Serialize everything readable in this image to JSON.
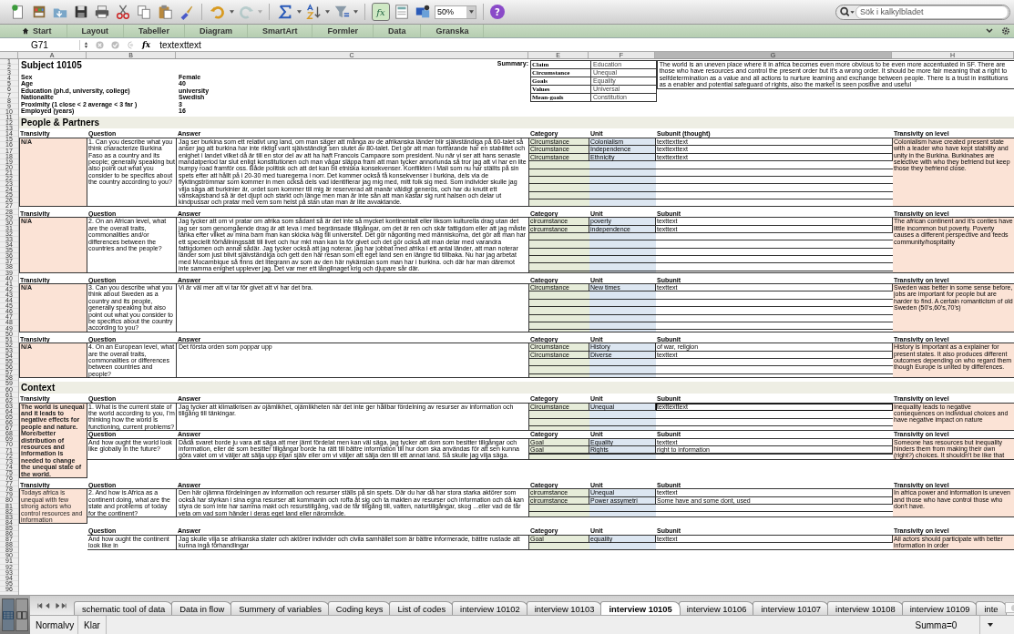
{
  "toolbar": {
    "zoom": "50%",
    "formula_button": "fx",
    "help": "?",
    "search_placeholder": "Sök i kalkylbladet"
  },
  "ribbon": {
    "tabs": [
      {
        "label": "Start",
        "selected": false
      },
      {
        "label": "Layout",
        "selected": false
      },
      {
        "label": "Tabeller",
        "selected": false
      },
      {
        "label": "Diagram",
        "selected": false
      },
      {
        "label": "SmartArt",
        "selected": false
      },
      {
        "label": "Formler",
        "selected": false
      },
      {
        "label": "Data",
        "selected": false
      },
      {
        "label": "Granska",
        "selected": false
      }
    ]
  },
  "formula_bar": {
    "cell": "G71",
    "fx": "fx",
    "value": "textexttext"
  },
  "columns": [
    {
      "label": "A",
      "selected": false
    },
    {
      "label": "B",
      "selected": false
    },
    {
      "label": "C",
      "selected": false
    },
    {
      "label": "E",
      "selected": false
    },
    {
      "label": "F",
      "selected": false
    },
    {
      "label": "G",
      "selected": true
    },
    {
      "label": "H",
      "selected": false
    }
  ],
  "row_numbers": [
    "1",
    "2",
    "3",
    "4",
    "5",
    "6",
    "7",
    "8",
    "9",
    "10",
    "11",
    "12",
    "13",
    "14",
    "15",
    "16",
    "17",
    "18",
    "19",
    "20",
    "21",
    "22",
    "23",
    "24",
    "25",
    "26",
    "27",
    "28",
    "29",
    "30",
    "31",
    "32",
    "33",
    "34",
    "35",
    "36",
    "37",
    "38",
    "39",
    "40",
    "41",
    "42",
    "43",
    "44",
    "45",
    "46",
    "47",
    "48",
    "49",
    "50",
    "51",
    "52",
    "53",
    "54",
    "55",
    "56",
    "57",
    "58",
    "59",
    "60",
    "61",
    "62",
    "63",
    "64",
    "65",
    "66",
    "67",
    "68",
    "69",
    "70",
    "71",
    "72",
    "73",
    "74",
    "75",
    "76",
    "77",
    "78",
    "79",
    "80",
    "81",
    "82",
    "83",
    "84",
    "85",
    "86",
    "87",
    "88",
    "89",
    "90",
    "91",
    "92",
    "93",
    "94",
    "95",
    "96"
  ],
  "subject": {
    "title": "Subject 10105",
    "fields": [
      {
        "label": "Sex",
        "value": "Female"
      },
      {
        "label": "Age",
        "value": "40"
      },
      {
        "label": "Education (ph.d, university, college)",
        "value": "university"
      },
      {
        "label": "Nationalite",
        "value": "Swedish"
      },
      {
        "label": "Proximity (1 close < 2 average < 3 far )",
        "value": "3"
      },
      {
        "label": "Employed (years)",
        "value": "16"
      }
    ],
    "summary_label": "Summary:",
    "summary": [
      {
        "key": "Claim",
        "value": "Education"
      },
      {
        "key": "Circumstance",
        "value": "Unequal"
      },
      {
        "key": "Goals",
        "value": "Equality"
      },
      {
        "key": "Values",
        "value": "Universal"
      },
      {
        "key": "Mean-goals",
        "value": "Constitution"
      }
    ],
    "summary_text": "The world is an uneven place where it in africa becomes even more obvious to be even more accentuated in SF. There are those who have resources and control the present order but it's a wrong order. It should be more fair meaning that a right to selfdetermination as a value and all actions to nurture learning and exchange between people. There is a trust in institutions as a enabler and potential safeguard of rights, also the market is seen positive and useful"
  },
  "sections": [
    {
      "title": "People & Partners",
      "blocks": [
        {
          "transivity": "N/A",
          "bold": true,
          "parts": [
            {
              "headers": {
                "transivity": "Transivity",
                "question": "Question",
                "answer": "Answer",
                "category": "Category",
                "unit": "Unit",
                "subunit": "Subunit (thought)",
                "level": "Transivity on level"
              },
              "question": "1. Can you describe what you think characterize Burkina Faso as a country and its people; generally speaking but also point out what you consider to be specifics about the country according to you?",
              "answer": "Jag ser burkina som ett relativt ung land, om man säger att många av de afrikanska länder blir självständiga på 60-talet så anser jag att burkina har inte riktigt varit självständigt sen slutet av 80-talet. Det gör att man fortfarande har en stabilitet och enighet i landet vilket då är till en stor del av att ha haft Francois Campaore som president. Nu när vi ser att hans senaste mandatperiod tar slut enligt konstitutionen och man vågar släppa fram att man tycker annorlunda så tror jag att vi har en lite bumpy road framför oss. Både politisk och att det kan bli etniska konsekvenser. Konflikten i Mali som nu har ställts på sin spets efter att hållt på i 20-30 med tuaregerna i norr. Det kommer också få konsekvenser i burkina, dels via de flyktingströmmar som kommer in men också dels vad identifierar jag mig med, mitt folk sig med. Som individer skulle jag vilja säga att burkinier är, ordet som kommer till mig är reserverad att manär väldigt generös, och har du knutit ett vänskapsband så är det djupt och starkt och länge men man är inte sån att man kastar sig runt halsen och delar ut kindpussar och pratar med vem som helst på stan utan man är lite avvaktande.",
              "codes": [
                {
                  "category": "Circumstance",
                  "unit": "Colonialism",
                  "subunit": "texttexttext",
                  "selected": false
                },
                {
                  "category": "Circumstance",
                  "unit": "Independence",
                  "subunit": "texttexttext",
                  "selected": false
                },
                {
                  "category": "Circumstance",
                  "unit": "Ethnicity",
                  "subunit": "texttexttext",
                  "selected": false
                }
              ],
              "level": "Colonialism have created present state with a leader who have kept stability and unity in the Burkina. Burkinabes are selective with who they befriend but keep those they befriend close."
            }
          ]
        },
        {
          "transivity": "N/A",
          "bold": true,
          "parts": [
            {
              "headers": {
                "transivity": "Transivity",
                "question": "Question",
                "answer": "Answer",
                "category": "Category",
                "unit": "Unit",
                "subunit": "Subunit",
                "level": "Transivity on level"
              },
              "question": "2. On an African level, what are the overall traits, commonalities and/or differences between the countries and the people?",
              "answer": "Jag tycker att om vi pratar om afrika som sådant så är det inte så mycket kontinentalt eller liksom kulturella drag utan det jag ser som genomgående drag är att leva i med begränsade tillgångar, om det är ren och skär fattigdom eller att jag måste tänka efter vilket av mina barn man kan skicka iväg till universitet. Det gör någonting med människorna, det gör att man har ett speciellt förhållningssätt till livet och hur mkt man kan ta för givet och det gör också att man delar med varandra fattigdomen och annat sådär. Jag tycker också att jag noterar, jag har jobbat med afrika i ett antal länder, att man noterar länder som just blivit självständiga och gett den här resan som ett eget land sen en längre tid tillbaka. Nu har jag arbetat med Mocambique så finns det litegrann av som av den här nykänslan som man har i burkina. och där har man däremot inte samma enighet upplever jag. Det var mer ett långlinaget krig och djupare sår där.",
              "codes": [
                {
                  "category": "circumstance",
                  "unit": "poverty",
                  "subunit": "texttext",
                  "selected": false
                },
                {
                  "category": "circumstance",
                  "unit": "independence",
                  "subunit": "texttext",
                  "selected": false
                }
              ],
              "level": "The african continent and it's conties have little incommon but poverty. Poverty causes a different perspective and feeds community/hospitality"
            }
          ]
        },
        {
          "transivity": "N/A",
          "bold": true,
          "parts": [
            {
              "headers": {
                "transivity": "Transivity",
                "question": "Question",
                "answer": "Answer",
                "category": "Category",
                "unit": "Unit",
                "subunit": "Subunit",
                "level": "Transivity on level"
              },
              "question": "3. Can you describe what you think about Sweden as a country and its people, generally speaking but also point out what you consider to be specifics about the country according to you?",
              "answer": "Vi är väl mer att vi tar för givet att vi har det bra.",
              "codes": [
                {
                  "category": "Circumstance",
                  "unit": "New times",
                  "subunit": "texttext",
                  "selected": false
                }
              ],
              "level": "Sweden was better in some sense before, jobs are important for people but are harder to find. A certain romanticism of old Sweden (50's,60's,70's)"
            }
          ]
        },
        {
          "transivity": "N/A",
          "bold": true,
          "parts": [
            {
              "headers": {
                "transivity": "Transivity",
                "question": "Question",
                "answer": "Answer",
                "category": "Category",
                "unit": "Unit",
                "subunit": "Subunit",
                "level": "Transivity on level"
              },
              "question": "4. On an European level, what are the overall traits, commonalities or differences between countries and people?",
              "answer": "Det första orden som poppar upp",
              "codes": [
                {
                  "category": "Circumstance",
                  "unit": "History",
                  "subunit": "of war, religion",
                  "selected": false
                },
                {
                  "category": "Circumstance",
                  "unit": "Diverse",
                  "subunit": "texttext",
                  "selected": false
                }
              ],
              "level": "History is important as a explainer for present states. It also produces different outcomes depending on who regard them though Europe is united by differences."
            }
          ]
        }
      ]
    },
    {
      "title": "Context",
      "blocks": [
        {
          "transivity": "The world is unequal and it leads to negative effects for people and nature. More/better distribution of resources and information is needed to change the unequal state of the world.",
          "bold": true,
          "parts": [
            {
              "headers": {
                "transivity": "Transivity",
                "question": "Question",
                "answer": "Answer",
                "category": "Category",
                "unit": "Unit",
                "subunit": "Subunit",
                "level": "Transivity on level"
              },
              "question": "1. What is the current state of the world according to you, I'm thinking how the world is functioning, current problems?",
              "answer": "Jag tycker att klimatkrisen av ojämlikhet, ojämlikheten när det inte ger hållbar fördelning av resurser av information och tillgång till tänkingar.",
              "codes": [
                {
                  "category": "Circumstance",
                  "unit": "Unequal",
                  "subunit": "texttexttext",
                  "selected": true
                }
              ],
              "level": "Inequality leads to negative consequences on individual choices and have negative impact on nature"
            },
            {
              "headers": {
                "question": "Question",
                "answer": "Answer",
                "category": "Category",
                "unit": "Unit",
                "subunit": "Subunit",
                "level": "Transivity on level"
              },
              "question": "And how ought the world look like globally in the future?",
              "answer": "Dådå svaret borde ju vara att säga att mer jämt fördelat men kan väl säga, jag tycker att dom som besitter tillgångar och information, eller de som besitter tillgångar borde ha rätt till bättre information till hur dom ska användas för att sen kunna göra valet om vi väljer att sälja upp eljan själv eller om vi väljer att sälja den till ett annat land. Så skulle jag vilja säga.",
              "codes": [
                {
                  "category": "Goal",
                  "unit": "Equality",
                  "subunit": "texttext",
                  "selected": false
                },
                {
                  "category": "Goal",
                  "unit": "Rights",
                  "subunit": "right to information",
                  "selected": false
                }
              ],
              "level": "Someone has resources but inequality hinders them from making their own (right?) choices. It shouldn't be like that"
            }
          ]
        },
        {
          "transivity": "Todays africa is unequal with few strong actors who control resources and information",
          "bold": false,
          "parts": [
            {
              "headers": {
                "transivity": "Transivity",
                "question": "Question",
                "answer": "Answer",
                "category": "Category",
                "unit": "Unit",
                "subunit": "Subunit",
                "level": "Transivity on level"
              },
              "question": "2. And how is Africa as a continent doing, what are the state and problems of today for the continent?",
              "answer": "Den här ojämna fördelningen av information och resurser ställs på sin spets. Där du har då har stora starka aktörer som också har styrkan i sina egna resurser att kommanin och roffa åt sig och ta makten av resurser och information och då kan styra de som inte har samma makt och resurstillgång, vad de får tillgång till, vatten, naturtillgångar, skog ...eller vad de får veta om vad som händer i deras eget land eller närområde.",
              "codes": [
                {
                  "category": "circumstance",
                  "unit": "Unequal",
                  "subunit": "texttext",
                  "selected": false
                },
                {
                  "category": "circumstance",
                  "unit": "Power assymetri",
                  "subunit": "Some have and some dont, used",
                  "selected": false
                }
              ],
              "level": "In africa power and information is uneven and those who have control those who don't have."
            }
          ]
        },
        {
          "parts": [
            {
              "headers": {
                "question": "Question",
                "answer": "Answer",
                "category": "Category",
                "unit": "Unit",
                "subunit": "Subunit",
                "level": "Transivity on level"
              },
              "question": "And how ought the continent look like in",
              "answer": "Jag skulle vilja se afrikanska stater och aktörer individer och civila samhället som är bättre informerade, bättre rustade att kunna ingå förhandlingar",
              "codes": [
                {
                  "category": "Goal",
                  "unit": "equality",
                  "subunit": "texttext",
                  "selected": false
                }
              ],
              "level": "All actors should participate with better information in order"
            }
          ]
        }
      ]
    }
  ],
  "sheet_tabs": [
    {
      "label": "schematic tool of data",
      "selected": false
    },
    {
      "label": "Data in flow",
      "selected": false
    },
    {
      "label": "Summery of variables",
      "selected": false
    },
    {
      "label": "Coding keys",
      "selected": false
    },
    {
      "label": "List of codes",
      "selected": false
    },
    {
      "label": "interview 10102",
      "selected": false
    },
    {
      "label": "interview 10103",
      "selected": false
    },
    {
      "label": "interview 10105",
      "selected": true
    },
    {
      "label": "interview 10106",
      "selected": false
    },
    {
      "label": "interview 10107",
      "selected": false
    },
    {
      "label": "interview 10108",
      "selected": false
    },
    {
      "label": "interview 10109",
      "selected": false
    },
    {
      "label": "inte",
      "selected": false
    }
  ],
  "status_bar": {
    "view": "Normalvy",
    "state": "Klar",
    "sum": "Summa=0"
  }
}
